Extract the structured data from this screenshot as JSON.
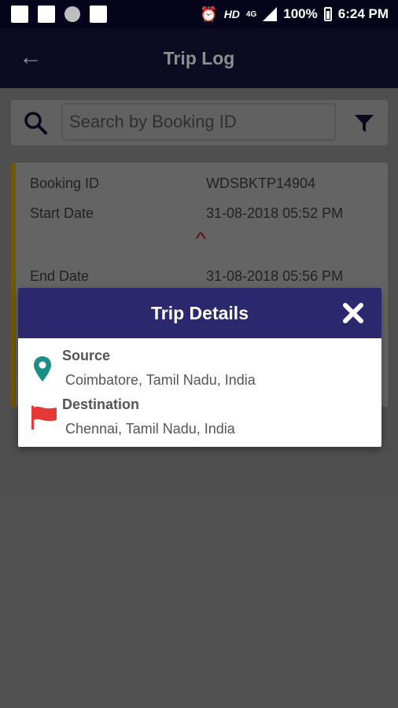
{
  "status_bar": {
    "battery": "100%",
    "time": "6:24 PM",
    "network": "HD",
    "network_small": "4G"
  },
  "app_bar": {
    "title": "Trip Log"
  },
  "search": {
    "placeholder": "Search by Booking ID"
  },
  "booking": {
    "rows": [
      {
        "label": "Booking ID",
        "value": "WDSBKTP14904"
      },
      {
        "label": "Start Date",
        "value": "31-08-2018 05:52 PM"
      },
      {
        "label": "End Date",
        "value": "31-08-2018 05:56 PM"
      }
    ]
  },
  "trip_details": {
    "title": "Trip Details",
    "source_label": "Source",
    "source_value": "Coimbatore, Tamil Nadu, India",
    "destination_label": "Destination",
    "destination_value": "Chennai, Tamil Nadu, India"
  },
  "colors": {
    "app_bar": "#0c0b21",
    "dialog_header": "#2c286e",
    "pin": "#1b8f86",
    "flag": "#e53935"
  }
}
